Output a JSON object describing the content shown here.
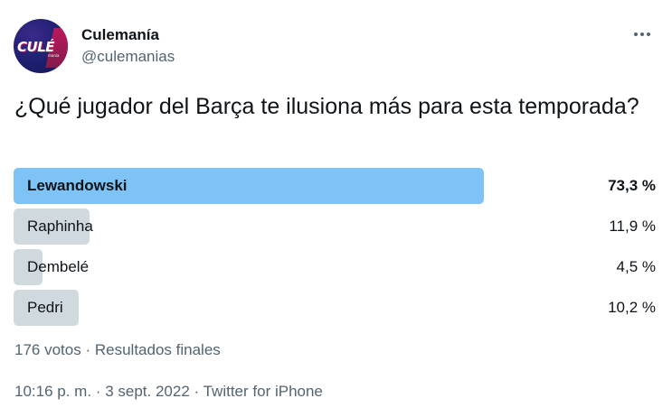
{
  "tweet": {
    "author": {
      "display_name": "Culemanía",
      "handle": "@culemanias",
      "avatar_text": "CULÉ",
      "avatar_subtext": "mania"
    },
    "more_icon": "more-horizontal-icon",
    "question": "¿Qué jugador del Barça te ilusiona más para esta temporada?",
    "poll": {
      "options": [
        {
          "label": "Lewandowski",
          "percent_text": "73,3 %",
          "percent": 73.3,
          "winner": true
        },
        {
          "label": "Raphinha",
          "percent_text": "11,9 %",
          "percent": 11.9,
          "winner": false
        },
        {
          "label": "Dembelé",
          "percent_text": "4,5 %",
          "percent": 4.5,
          "winner": false
        },
        {
          "label": "Pedri",
          "percent_text": "10,2 %",
          "percent": 10.2,
          "winner": false
        }
      ],
      "votes": "176 votos",
      "separator": "·",
      "status": "Resultados finales"
    },
    "meta": {
      "time": "10:16 p. m.",
      "date": "3 sept. 2022",
      "source": "Twitter for iPhone",
      "separator": "·"
    },
    "colors": {
      "winner_bar": "#7ec3f6",
      "other_bar": "#cfd9de",
      "secondary_text": "#536471",
      "primary_text": "#0f1419"
    }
  }
}
